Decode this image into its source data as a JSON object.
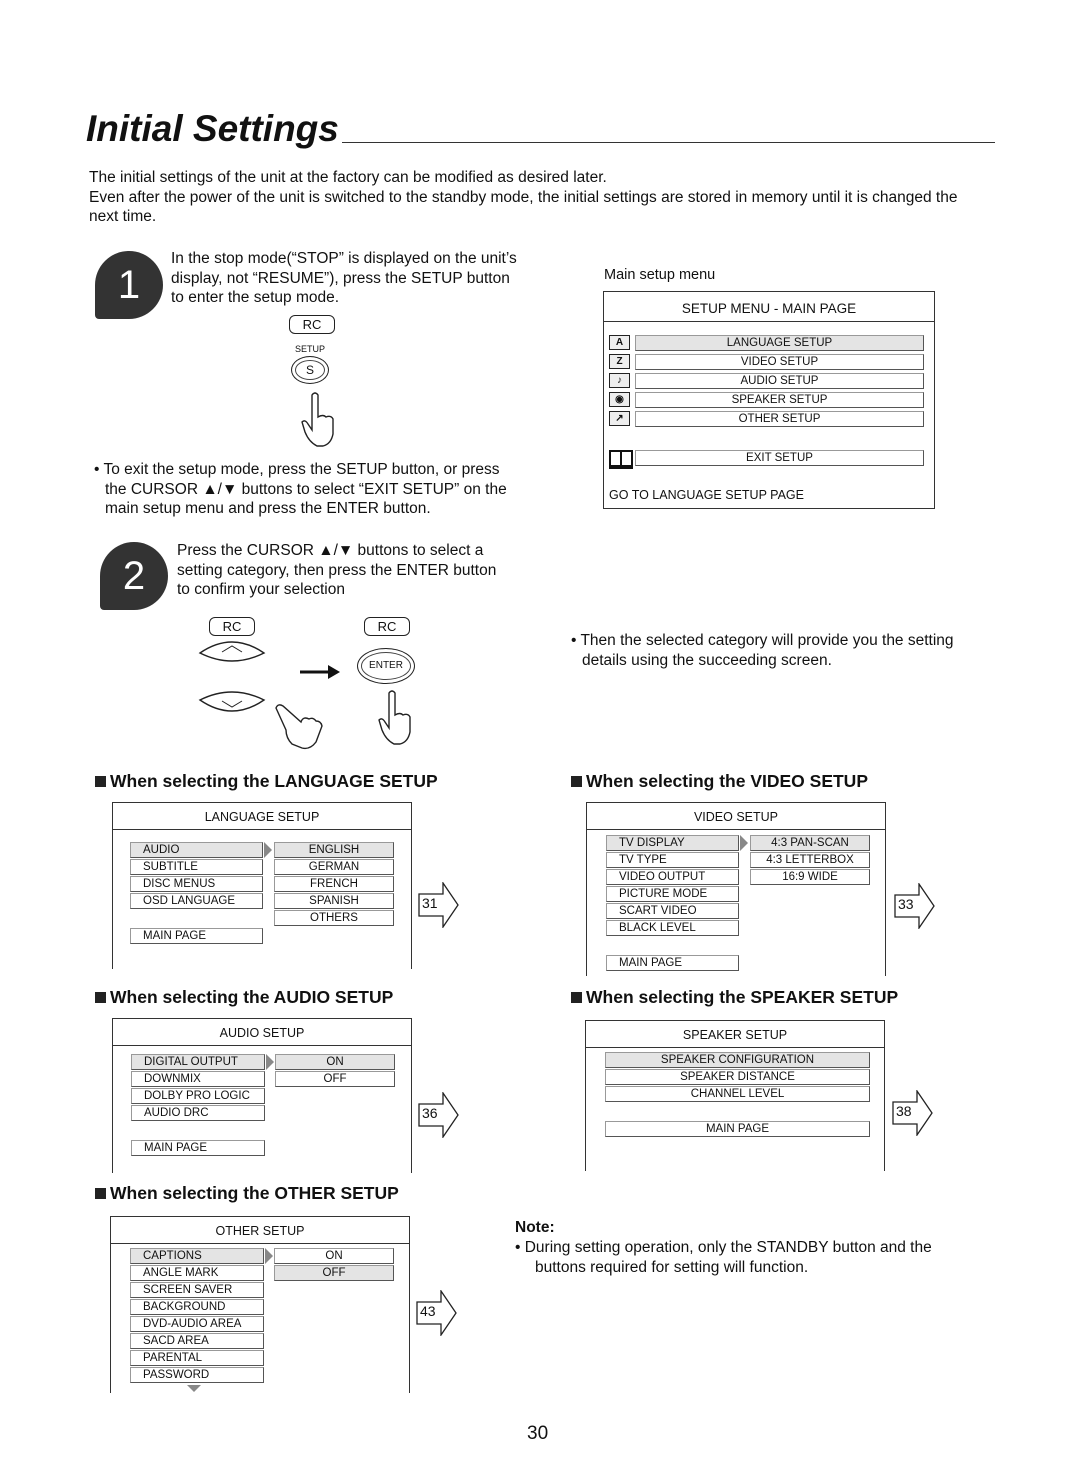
{
  "title": "Initial Settings",
  "intro": [
    "The initial settings of the unit at the factory can be modified as desired later.",
    "Even after the power of the unit is switched to the standby mode, the initial settings are stored in memory until it is changed the next time."
  ],
  "step1": {
    "number": "1",
    "lines": [
      "In the stop mode(“STOP” is displayed on the unit’s",
      "display, not “RESUME”), press the SETUP button",
      "to enter the setup mode."
    ],
    "rc": "RC",
    "setup_label": "SETUP",
    "button": "S"
  },
  "exit_note": [
    "• To exit the setup mode, press the SETUP button, or press",
    "the CURSOR ▲/▼ buttons to select “EXIT SETUP” on the",
    "main setup menu and press the ENTER button."
  ],
  "step2": {
    "number": "2",
    "lines": [
      "Press the CURSOR ▲/▼ buttons to select a",
      "setting category, then press the ENTER button",
      "to confirm your selection"
    ],
    "rc_left": "RC",
    "rc_right": "RC",
    "enter": "ENTER"
  },
  "main_menu": {
    "caption": "Main setup menu",
    "title": "SETUP MENU - MAIN PAGE",
    "items": [
      {
        "label": "LANGUAGE SETUP",
        "icon": "language-icon"
      },
      {
        "label": "VIDEO SETUP",
        "icon": "video-icon"
      },
      {
        "label": "AUDIO SETUP",
        "icon": "audio-icon"
      },
      {
        "label": "SPEAKER SETUP",
        "icon": "speaker-icon"
      },
      {
        "label": "OTHER SETUP",
        "icon": "other-icon"
      }
    ],
    "exit": "EXIT SETUP",
    "status": "GO TO LANGUAGE SETUP PAGE"
  },
  "then_note": [
    "• Then the selected category will provide you the setting",
    "details using the succeeding screen."
  ],
  "sections": {
    "language": "When selecting the LANGUAGE SETUP",
    "video": "When selecting the VIDEO SETUP",
    "audio": "When selecting the AUDIO SETUP",
    "speaker": "When selecting the SPEAKER SETUP",
    "other": "When selecting the OTHER SETUP"
  },
  "menus": {
    "language": {
      "title": "LANGUAGE SETUP",
      "left": [
        "AUDIO",
        "SUBTITLE",
        "DISC MENUS",
        "OSD LANGUAGE"
      ],
      "right": [
        "ENGLISH",
        "GERMAN",
        "FRENCH",
        "SPANISH",
        "OTHERS"
      ],
      "right_selected": 0,
      "main": "MAIN PAGE",
      "page": "31"
    },
    "video": {
      "title": "VIDEO SETUP",
      "left": [
        "TV DISPLAY",
        "TV TYPE",
        "VIDEO OUTPUT",
        "PICTURE MODE",
        "SCART VIDEO",
        "BLACK LEVEL"
      ],
      "right": [
        "4:3 PAN-SCAN",
        "4:3 LETTERBOX",
        "16:9 WIDE"
      ],
      "right_selected": 0,
      "main": "MAIN PAGE",
      "page": "33"
    },
    "audio": {
      "title": "AUDIO SETUP",
      "left": [
        "DIGITAL OUTPUT",
        "DOWNMIX",
        "DOLBY PRO LOGIC",
        "AUDIO DRC"
      ],
      "right": [
        "ON",
        "OFF"
      ],
      "right_selected": 0,
      "main": "MAIN PAGE",
      "page": "36"
    },
    "speaker": {
      "title": "SPEAKER SETUP",
      "left": [
        "SPEAKER CONFIGURATION",
        "SPEAKER DISTANCE",
        "CHANNEL LEVEL"
      ],
      "right": [],
      "main": "MAIN PAGE",
      "page": "38"
    },
    "other": {
      "title": "OTHER SETUP",
      "left": [
        "CAPTIONS",
        "ANGLE MARK",
        "SCREEN SAVER",
        "BACKGROUND",
        "DVD-AUDIO AREA",
        "SACD AREA",
        "PARENTAL",
        "PASSWORD"
      ],
      "right": [
        "ON",
        "OFF"
      ],
      "right_selected": 1,
      "main": null,
      "page": "43"
    }
  },
  "note": {
    "label": "Note:",
    "lines": [
      "• During setting operation, only the STANDBY button and the",
      "buttons required for setting will function."
    ]
  },
  "page_number": "30"
}
